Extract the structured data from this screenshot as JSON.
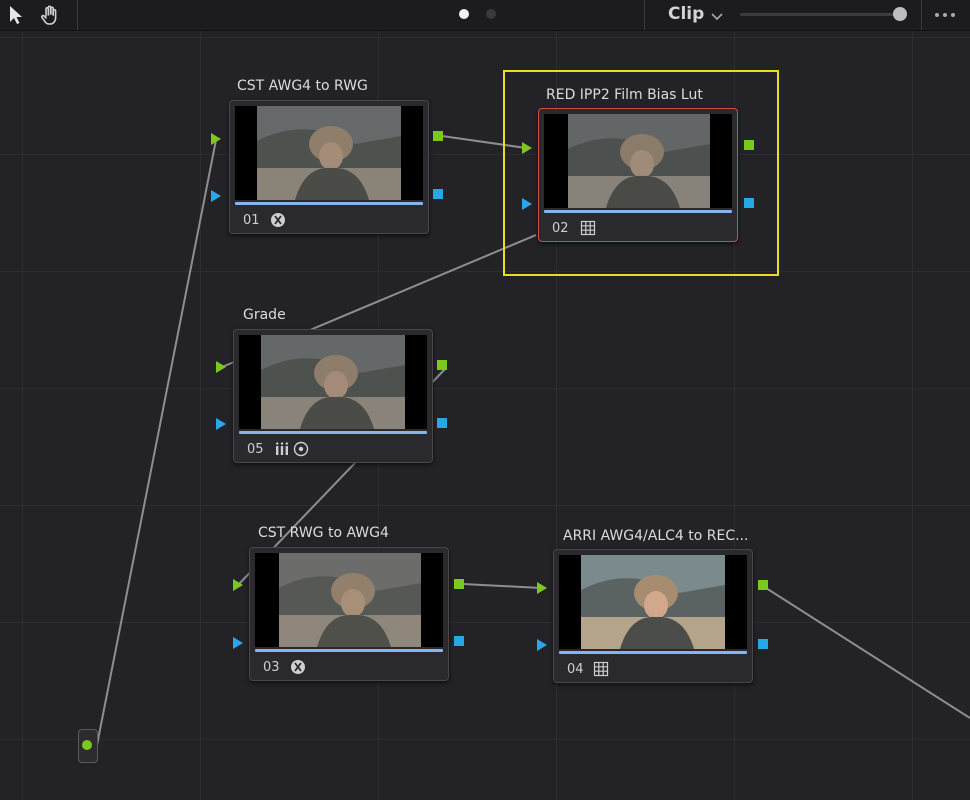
{
  "toolbar": {
    "mode_label": "Clip",
    "pointer_tool": "pointer-icon",
    "hand_tool": "hand-icon",
    "more_menu": "more-icon"
  },
  "nodes": [
    {
      "id": "01",
      "title": "CST AWG4 to RWG",
      "number": "01",
      "tool_icon": "resolve-fx-icon"
    },
    {
      "id": "02",
      "title": "RED IPP2 Film Bias Lut",
      "number": "02",
      "tool_icon": "lut-grid-icon",
      "selected": true
    },
    {
      "id": "05",
      "title": "Grade",
      "number": "05",
      "tool_icon": "color-bars-icon",
      "tool_icon_2": "circle-target-icon"
    },
    {
      "id": "03",
      "title": "CST RWG  to AWG4",
      "number": "03",
      "tool_icon": "resolve-fx-icon"
    },
    {
      "id": "04",
      "title": "ARRI AWG4/ALC4 to REC...",
      "number": "04",
      "tool_icon": "lut-grid-icon"
    }
  ],
  "colors": {
    "background": "#232327",
    "rgb_port": "#7bc81e",
    "alpha_port": "#26a8e6",
    "selected_border": "#d0503e",
    "highlight_box": "#e8de1c",
    "progress_bar": "#86b4ee"
  }
}
